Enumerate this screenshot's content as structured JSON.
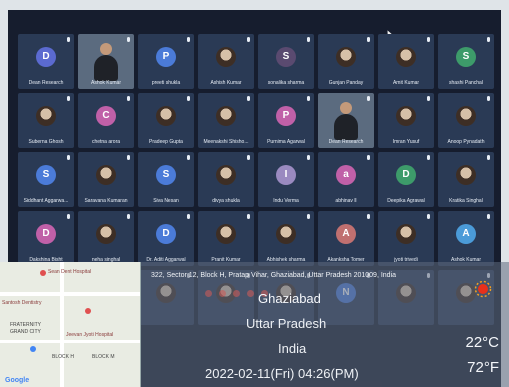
{
  "participants": [
    {
      "name": "Dean Research",
      "initial": "D",
      "color": "#5b6ad0",
      "type": "avatar"
    },
    {
      "name": "Ashok Kumar",
      "initial": "",
      "color": "",
      "type": "video"
    },
    {
      "name": "preeti shukla",
      "initial": "P",
      "color": "#4b7bd8",
      "type": "avatar"
    },
    {
      "name": "Ashish Kumar",
      "initial": "",
      "color": "",
      "type": "photo"
    },
    {
      "name": "sonalika sharma",
      "initial": "S",
      "color": "#5a4a70",
      "type": "avatar"
    },
    {
      "name": "Gunjan Panday",
      "initial": "",
      "color": "",
      "type": "photo"
    },
    {
      "name": "Amit Kumar",
      "initial": "",
      "color": "",
      "type": "photo"
    },
    {
      "name": "shashi Panchal",
      "initial": "S",
      "color": "#3d9b6a",
      "type": "avatar"
    },
    {
      "name": "Suberna Ghosh",
      "initial": "",
      "color": "",
      "type": "photo"
    },
    {
      "name": "chetna arora",
      "initial": "C",
      "color": "#c060a8",
      "type": "avatar"
    },
    {
      "name": "Pradeep Gupta",
      "initial": "",
      "color": "",
      "type": "photo"
    },
    {
      "name": "Meenakshi Shisho...",
      "initial": "",
      "color": "",
      "type": "photo"
    },
    {
      "name": "Purnima Agarwal",
      "initial": "P",
      "color": "#c060a8",
      "type": "avatar"
    },
    {
      "name": "Dean Research",
      "initial": "",
      "color": "",
      "type": "video"
    },
    {
      "name": "Imran Yusuf",
      "initial": "",
      "color": "",
      "type": "photo"
    },
    {
      "name": "Anoop Pynadath",
      "initial": "",
      "color": "",
      "type": "photo"
    },
    {
      "name": "Siddhant Aggarwa...",
      "initial": "S",
      "color": "#4b7bd8",
      "type": "avatar"
    },
    {
      "name": "Saravana Kumaran",
      "initial": "",
      "color": "",
      "type": "photo"
    },
    {
      "name": "Siva Nesan",
      "initial": "S",
      "color": "#4b7bd8",
      "type": "avatar"
    },
    {
      "name": "divya shukla",
      "initial": "",
      "color": "",
      "type": "photo"
    },
    {
      "name": "Indu Verma",
      "initial": "I",
      "color": "#9a8ac0",
      "type": "avatar"
    },
    {
      "name": "abhinav ll",
      "initial": "a",
      "color": "#c060a8",
      "type": "avatar"
    },
    {
      "name": "Deepika Agrawal",
      "initial": "D",
      "color": "#3d9b6a",
      "type": "avatar"
    },
    {
      "name": "Kratika Singhal",
      "initial": "",
      "color": "",
      "type": "photo"
    },
    {
      "name": "Dakshina Bisht",
      "initial": "D",
      "color": "#c060a8",
      "type": "avatar"
    },
    {
      "name": "neha singhal",
      "initial": "",
      "color": "",
      "type": "photo"
    },
    {
      "name": "Dr. Aditi Aggarwal",
      "initial": "D",
      "color": "#4b7bd8",
      "type": "avatar"
    },
    {
      "name": "Pranit Kumar",
      "initial": "",
      "color": "",
      "type": "photo"
    },
    {
      "name": "Abhishek sharma",
      "initial": "",
      "color": "",
      "type": "photo"
    },
    {
      "name": "Akanksha Tomer",
      "initial": "A",
      "color": "#c07070",
      "type": "avatar"
    },
    {
      "name": "jyoti trivedi",
      "initial": "",
      "color": "",
      "type": "photo"
    },
    {
      "name": "Ashok Kumar",
      "initial": "A",
      "color": "#4b9bd8",
      "type": "avatar"
    },
    {
      "name": "",
      "initial": "",
      "color": "",
      "type": "photo"
    },
    {
      "name": "",
      "initial": "",
      "color": "",
      "type": "photo"
    },
    {
      "name": "",
      "initial": "",
      "color": "",
      "type": "photo"
    },
    {
      "name": "",
      "initial": "",
      "color": "",
      "type": "photo"
    },
    {
      "name": "",
      "initial": "",
      "color": "",
      "type": "photo"
    },
    {
      "name": "",
      "initial": "N",
      "color": "#4b7bd8",
      "type": "avatar"
    },
    {
      "name": "",
      "initial": "",
      "color": "",
      "type": "photo"
    },
    {
      "name": "",
      "initial": "",
      "color": "",
      "type": "photo"
    }
  ],
  "location": {
    "address": "322, Sector 12, Block H, Pratap Vihar, Ghaziabad, Uttar Pradesh 201009, India",
    "city": "Ghaziabad",
    "state": "Uttar Pradesh",
    "country": "India",
    "datetime": "2022-02-11(Fri)  04:26(PM)",
    "temp_c": "22°C",
    "temp_f": "72°F",
    "weather_icon": "sun-icon"
  },
  "map": {
    "labels": [
      "Sean Dent Hospital",
      "Santosh Dentistry",
      "FRATERNITY",
      "GRAND CITY",
      "Jeevan Jyoti Hospital",
      "BLOCK H",
      "BLOCK M",
      "Google"
    ],
    "brand": "Google"
  }
}
